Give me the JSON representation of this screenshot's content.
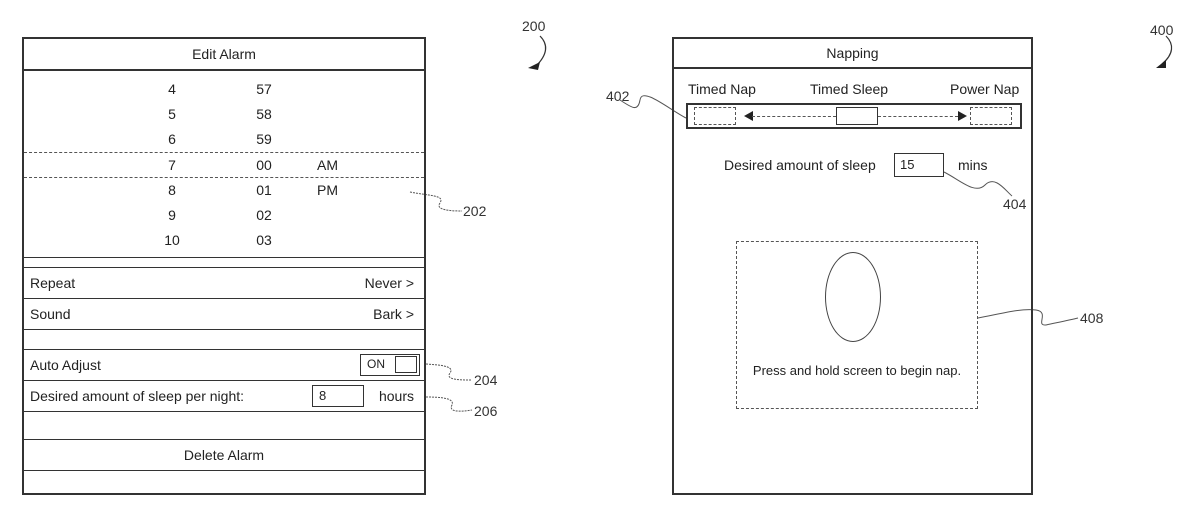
{
  "figures": {
    "edit_alarm": {
      "ref_number": "200",
      "title": "Edit Alarm",
      "picker": {
        "ref_number": "202",
        "rows": [
          {
            "hour": "4",
            "minute": "57",
            "period": ""
          },
          {
            "hour": "5",
            "minute": "58",
            "period": ""
          },
          {
            "hour": "6",
            "minute": "59",
            "period": ""
          },
          {
            "hour": "7",
            "minute": "00",
            "period": "AM"
          },
          {
            "hour": "8",
            "minute": "01",
            "period": "PM"
          },
          {
            "hour": "9",
            "minute": "02",
            "period": ""
          },
          {
            "hour": "10",
            "minute": "03",
            "period": ""
          }
        ],
        "selected": {
          "hour": "7",
          "minute": "00",
          "period": "AM"
        }
      },
      "repeat": {
        "label": "Repeat",
        "value": "Never >"
      },
      "sound": {
        "label": "Sound",
        "value": "Bark >"
      },
      "auto_adjust": {
        "label": "Auto Adjust",
        "toggle_label": "ON",
        "ref_number": "204"
      },
      "sleep_per_night": {
        "label": "Desired amount of sleep per night:",
        "value": "8",
        "unit": "hours",
        "ref_number": "206"
      },
      "delete_label": "Delete Alarm"
    },
    "napping": {
      "ref_number": "400",
      "title": "Napping",
      "modes": {
        "ref_number": "402",
        "options": [
          "Timed Nap",
          "Timed Sleep",
          "Power Nap"
        ],
        "selected": "Timed Sleep"
      },
      "desired_sleep": {
        "label": "Desired amount of sleep",
        "value": "15",
        "unit": "mins",
        "ref_number": "404"
      },
      "touch_area": {
        "text": "Press and hold screen to begin nap.",
        "ref_number": "408"
      }
    }
  }
}
